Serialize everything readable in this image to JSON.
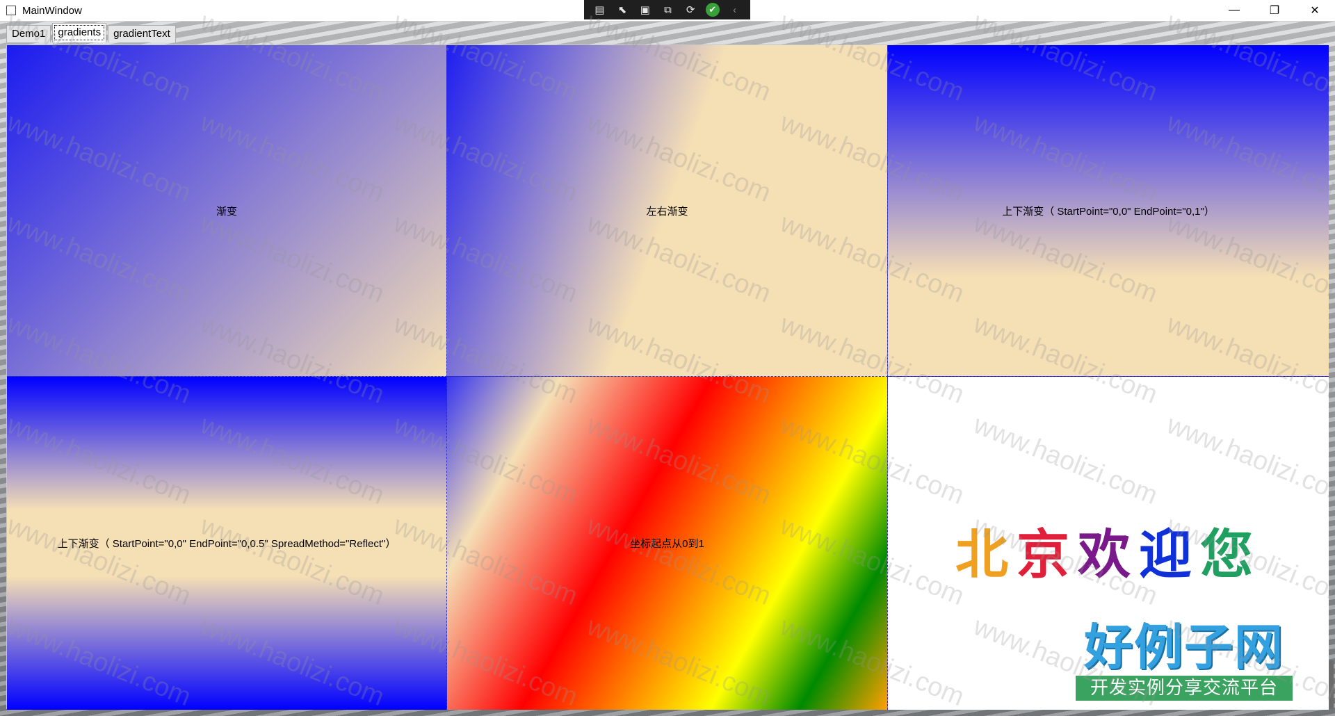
{
  "window": {
    "title": "MainWindow"
  },
  "debug_toolbar": {
    "icons": [
      "live-visual-tree-icon",
      "select-element-icon",
      "display-layout-adorners-icon",
      "track-focus-icon",
      "hot-reload-icon",
      "success-check-icon",
      "collapse-chevron-icon"
    ]
  },
  "window_controls": {
    "minimize": "—",
    "restore": "❐",
    "close": "✕"
  },
  "tabs": [
    {
      "label": "Demo1",
      "selected": false
    },
    {
      "label": "gradients",
      "selected": true
    },
    {
      "label": "gradientText",
      "selected": false
    }
  ],
  "cells": [
    {
      "label": "渐变"
    },
    {
      "label": "左右渐变"
    },
    {
      "label": "上下渐变（ StartPoint=\"0,0\" EndPoint=\"0,1\"）"
    },
    {
      "label": "上下渐变（ StartPoint=\"0,0\" EndPoint=\"0,0.5\" SpreadMethod=\"Reflect\"）"
    },
    {
      "label": "坐标起点从0到1"
    }
  ],
  "welcome_text": {
    "chars": [
      "北",
      "京",
      "欢",
      "迎",
      "您"
    ],
    "colors": [
      "#f0a020",
      "#e0203a",
      "#7a1a8a",
      "#1030d8",
      "#20a060"
    ]
  },
  "logo": {
    "title": "好例子网",
    "subtitle": "开发实例分享交流平台"
  },
  "watermark": "www.haolizi.com",
  "colors": {
    "blue": "#0000ff",
    "wheat": "#f5deb3",
    "dash_border": "#2c2cc8"
  }
}
